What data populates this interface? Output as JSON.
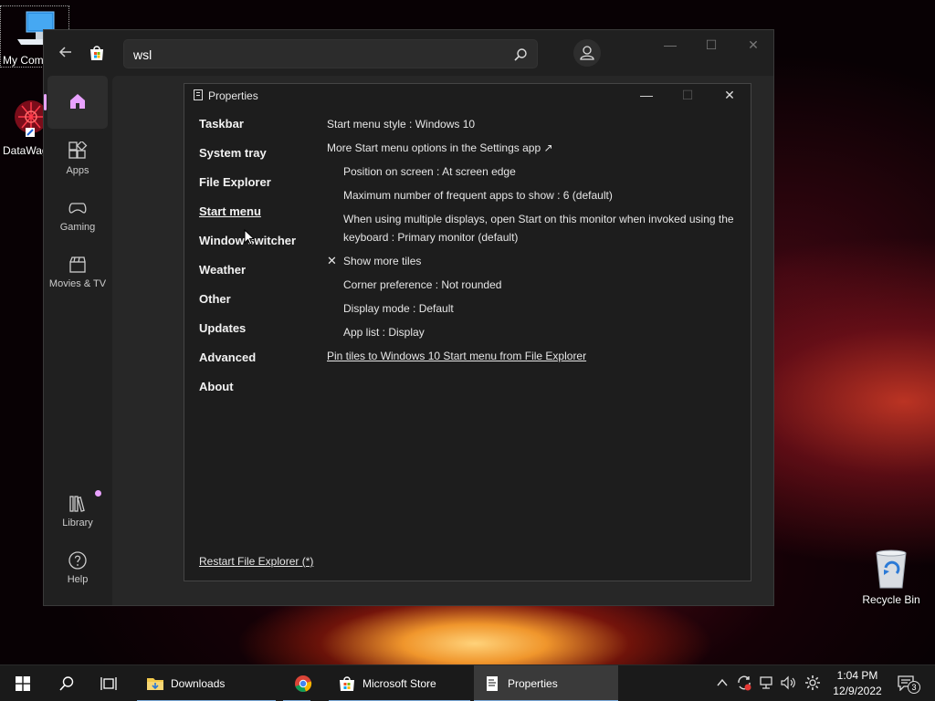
{
  "desktop": {
    "icons": [
      {
        "label": "My Com"
      },
      {
        "label": "DataWag"
      },
      {
        "label": "Recycle Bin"
      }
    ]
  },
  "store": {
    "search": {
      "value": "wsl"
    },
    "nav": {
      "apps": "Apps",
      "gaming": "Gaming",
      "movies": "Movies & TV",
      "library": "Library",
      "help": "Help"
    }
  },
  "properties": {
    "title": "Properties",
    "menu": [
      "Taskbar",
      "System tray",
      "File Explorer",
      "Start menu",
      "Window switcher",
      "Weather",
      "Other",
      "Updates",
      "Advanced",
      "About"
    ],
    "active_menu": "Start menu",
    "settings": {
      "style": "Start menu style : Windows 10",
      "more_options": "More Start menu options in the Settings app ↗",
      "position": "Position on screen : At screen edge",
      "max_apps": "Maximum number of frequent apps to show : 6 (default)",
      "multi_display": "When using multiple displays, open Start on this monitor when invoked using the keyboard : Primary monitor (default)",
      "show_tiles_mark": "✕",
      "show_tiles": "Show more tiles",
      "corner": "Corner preference : Not rounded",
      "display_mode": "Display mode : Default",
      "app_list": "App list : Display",
      "pin_tiles": "Pin tiles to Windows 10 Start menu from File Explorer"
    },
    "restart": "Restart File Explorer (*)"
  },
  "taskbar": {
    "apps": [
      {
        "label": "Downloads"
      },
      {
        "label": "Microsoft Store"
      },
      {
        "label": "Properties"
      }
    ],
    "clock": {
      "time": "1:04 PM",
      "date": "12/9/2022"
    },
    "notification_count": "3"
  },
  "colors": {
    "accent": "#e9a2ff",
    "taskbar_underline": "#7aa8d8"
  }
}
